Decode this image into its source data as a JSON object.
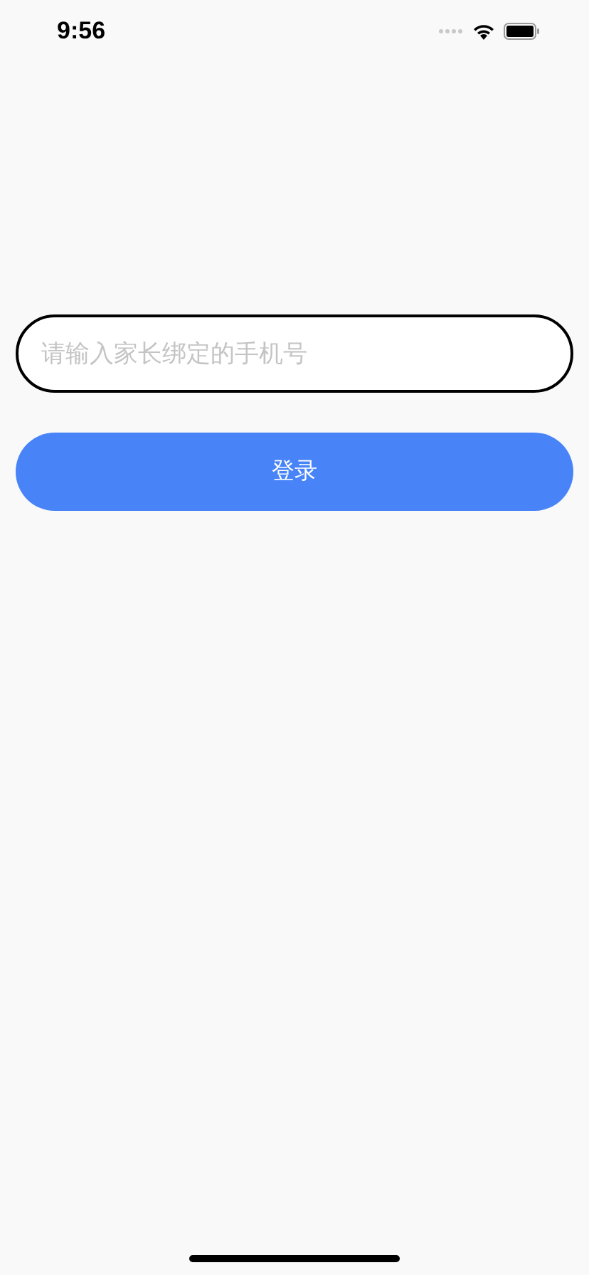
{
  "status_bar": {
    "time": "9:56"
  },
  "phone_field": {
    "placeholder": "请输入家长绑定的手机号"
  },
  "login_button": {
    "label": "登录"
  }
}
